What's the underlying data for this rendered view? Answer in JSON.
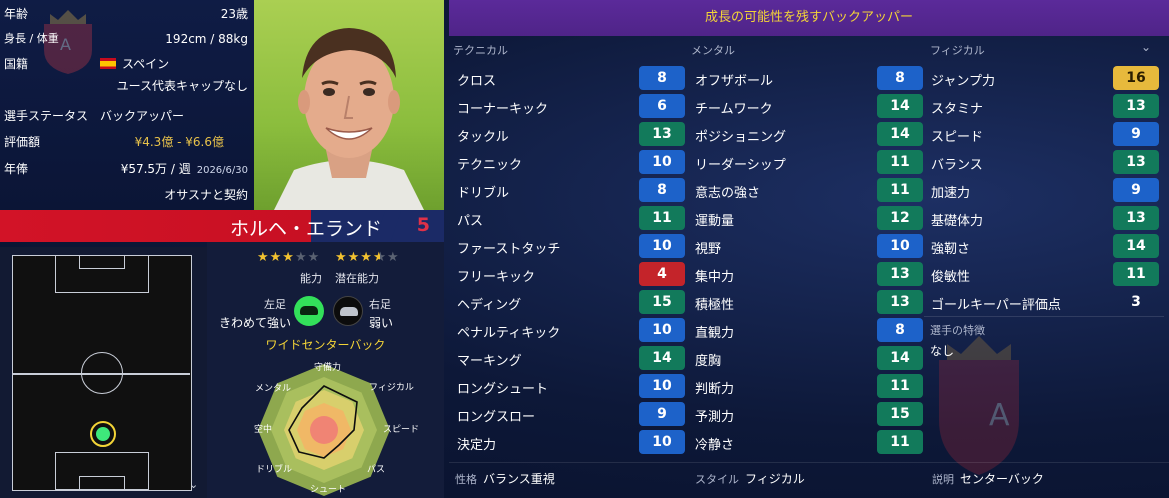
{
  "profile": {
    "age_label": "年齢",
    "age_value": "23歳",
    "hw_label": "身長 / 体重",
    "hw_value": "192cm / 88kg",
    "nation_label": "国籍",
    "nation_value": "スペイン",
    "youth_caps": "ユース代表キャップなし",
    "status_label": "選手ステータス",
    "status_value": "バックアッパー",
    "value_label": "評価額",
    "value_value": "¥4.3億 - ¥6.6億",
    "wage_label": "年俸",
    "wage_value": "¥57.5万 / 週",
    "wage_date": "2026/6/30",
    "contract": "オサスナと契約"
  },
  "player": {
    "name": "ホルヘ・エランド",
    "number": "5"
  },
  "rating": {
    "current_stars": 3,
    "potential_stars": 3.5,
    "max_stars": 5,
    "ability_label": "能力",
    "potential_label": "潜在能力"
  },
  "feet": {
    "left_label": "左足",
    "left_value": "きわめて強い",
    "right_label": "右足",
    "right_value": "弱い"
  },
  "position_label": "ワイドセンターバック",
  "radar_labels": {
    "top": "守備力",
    "top_right": "フィジカル",
    "right": "スピード",
    "bottom_right": "パス",
    "bottom": "シュート",
    "bottom_left": "ドリブル",
    "left": "空中",
    "top_left": "メンタル"
  },
  "banner": "成長の可能性を残すバックアッパー",
  "columns": {
    "technical": "テクニカル",
    "mental": "メンタル",
    "physical": "フィジカル"
  },
  "technical": [
    {
      "name": "クロス",
      "value": "8",
      "color": "blue"
    },
    {
      "name": "コーナーキック",
      "value": "6",
      "color": "blue"
    },
    {
      "name": "タックル",
      "value": "13",
      "color": "green"
    },
    {
      "name": "テクニック",
      "value": "10",
      "color": "blue"
    },
    {
      "name": "ドリブル",
      "value": "8",
      "color": "blue"
    },
    {
      "name": "パス",
      "value": "11",
      "color": "green"
    },
    {
      "name": "ファーストタッチ",
      "value": "10",
      "color": "blue"
    },
    {
      "name": "フリーキック",
      "value": "4",
      "color": "red"
    },
    {
      "name": "ヘディング",
      "value": "15",
      "color": "green"
    },
    {
      "name": "ペナルティキック",
      "value": "10",
      "color": "blue"
    },
    {
      "name": "マーキング",
      "value": "14",
      "color": "green"
    },
    {
      "name": "ロングシュート",
      "value": "10",
      "color": "blue"
    },
    {
      "name": "ロングスロー",
      "value": "9",
      "color": "blue"
    },
    {
      "name": "決定力",
      "value": "10",
      "color": "blue"
    }
  ],
  "mental": [
    {
      "name": "オフザボール",
      "value": "8",
      "color": "blue"
    },
    {
      "name": "チームワーク",
      "value": "14",
      "color": "green"
    },
    {
      "name": "ポジショニング",
      "value": "14",
      "color": "green"
    },
    {
      "name": "リーダーシップ",
      "value": "11",
      "color": "green"
    },
    {
      "name": "意志の強さ",
      "value": "11",
      "color": "green"
    },
    {
      "name": "運動量",
      "value": "12",
      "color": "green"
    },
    {
      "name": "視野",
      "value": "10",
      "color": "blue"
    },
    {
      "name": "集中力",
      "value": "13",
      "color": "green"
    },
    {
      "name": "積極性",
      "value": "13",
      "color": "green"
    },
    {
      "name": "直観力",
      "value": "8",
      "color": "blue"
    },
    {
      "name": "度胸",
      "value": "14",
      "color": "green"
    },
    {
      "name": "判断力",
      "value": "11",
      "color": "green"
    },
    {
      "name": "予測力",
      "value": "15",
      "color": "green"
    },
    {
      "name": "冷静さ",
      "value": "11",
      "color": "green"
    }
  ],
  "physical": [
    {
      "name": "ジャンプ力",
      "value": "16",
      "color": "gold"
    },
    {
      "name": "スタミナ",
      "value": "13",
      "color": "green"
    },
    {
      "name": "スピード",
      "value": "9",
      "color": "blue"
    },
    {
      "name": "バランス",
      "value": "13",
      "color": "green"
    },
    {
      "name": "加速力",
      "value": "9",
      "color": "blue"
    },
    {
      "name": "基礎体力",
      "value": "13",
      "color": "green"
    },
    {
      "name": "強靭さ",
      "value": "14",
      "color": "green"
    },
    {
      "name": "俊敏性",
      "value": "11",
      "color": "green"
    },
    {
      "name": "ゴールキーパー評価点",
      "value": "3",
      "color": "none"
    }
  ],
  "traits": {
    "label": "選手の特徴",
    "value": "なし"
  },
  "footer": {
    "personality_label": "性格",
    "personality_value": "バランス重視",
    "style_label": "スタイル",
    "style_value": "フィジカル",
    "desc_label": "説明",
    "desc_value": "センターバック"
  },
  "colors": {
    "blue": "#1d62c9",
    "green": "#127a5b",
    "red": "#c4242a",
    "gold": "#e7b93c",
    "banner": "#5b2a9a",
    "team_red": "#d21327"
  }
}
